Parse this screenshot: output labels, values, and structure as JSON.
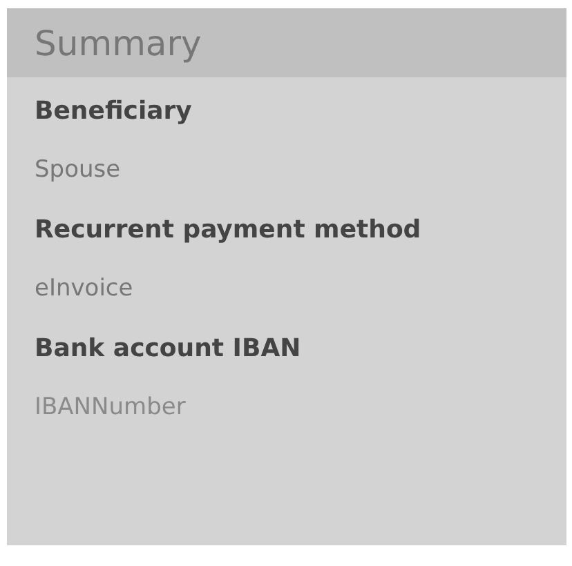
{
  "title": "Summary",
  "fields": [
    {
      "label": "Beneficiary",
      "value": "Spouse"
    },
    {
      "label": "Recurrent payment method",
      "value": "eInvoice"
    },
    {
      "label": "Bank account IBAN",
      "value": "IBANNumber"
    }
  ]
}
